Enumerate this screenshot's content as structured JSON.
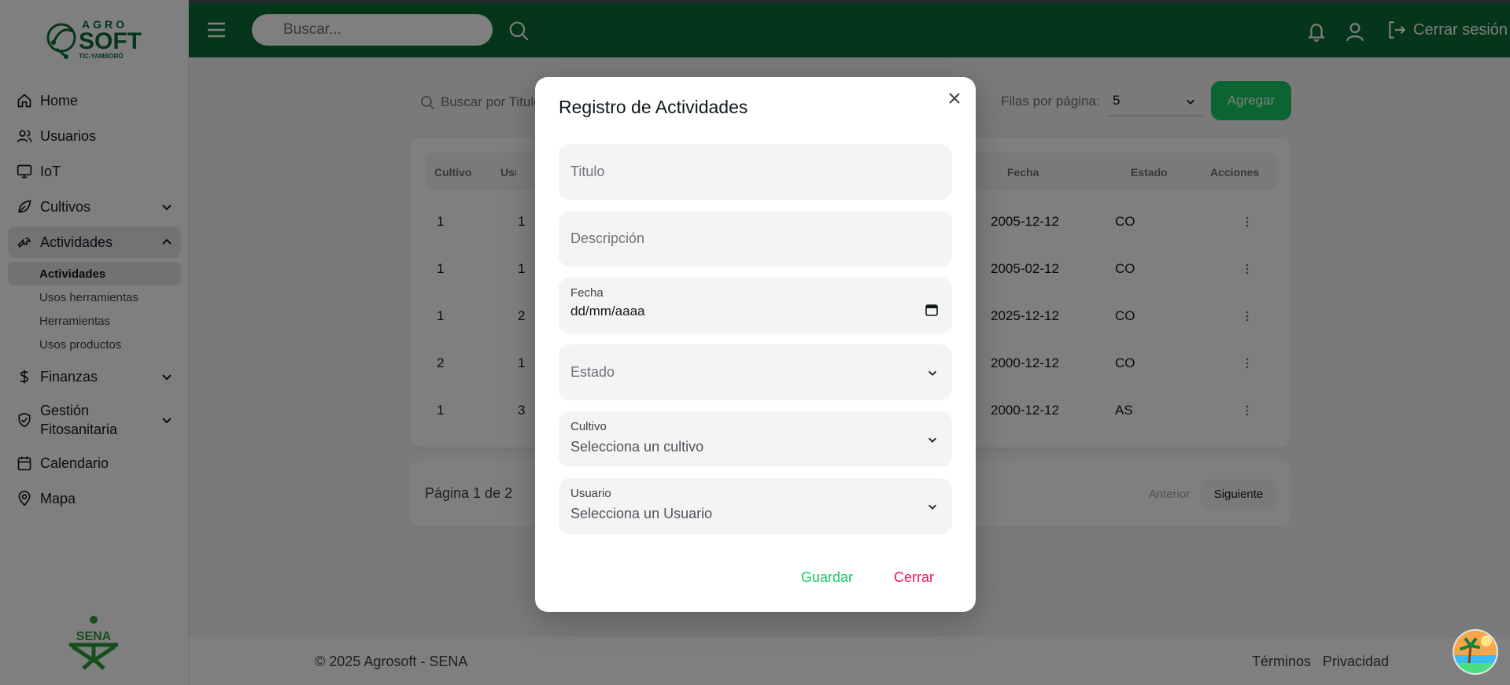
{
  "brand": {
    "logo_top": "AGRO",
    "logo_main": "SOFT",
    "logo_sub": "TIC-YAMBORÓ",
    "sena_text": "SENA",
    "primary_color": "#0b6b36",
    "accent_green": "#17c964",
    "danger_red": "#f31260"
  },
  "sidebar": {
    "items": [
      {
        "label": "Home",
        "icon": "home-icon"
      },
      {
        "label": "Usuarios",
        "icon": "users-icon"
      },
      {
        "label": "IoT",
        "icon": "monitor-icon"
      },
      {
        "label": "Cultivos",
        "icon": "leaf-icon"
      },
      {
        "label": "Actividades",
        "icon": "wrench-icon"
      },
      {
        "label": "Finanzas",
        "icon": "dollar-icon"
      },
      {
        "label": "Gestión Fitosanitaria",
        "icon": "shield-icon"
      },
      {
        "label": "Calendario",
        "icon": "calendar-icon"
      },
      {
        "label": "Mapa",
        "icon": "map-pin-icon"
      }
    ],
    "sub_items": [
      "Actividades",
      "Usos herramientas",
      "Herramientas",
      "Usos productos"
    ]
  },
  "header": {
    "search_placeholder": "Buscar...",
    "logout_label": "Cerrar sesión"
  },
  "main": {
    "search_placeholder": "Buscar por Titulo",
    "rows_label": "Filas por página:",
    "rows_value": "5",
    "add_label": "Agregar",
    "columns": [
      "Cultivo",
      "Usuario",
      "Fecha",
      "Estado",
      "Acciones"
    ],
    "rows": [
      {
        "cultivo": "1",
        "usuario": "1",
        "fecha": "2005-12-12",
        "estado": "CO"
      },
      {
        "cultivo": "1",
        "usuario": "1",
        "fecha": "2005-02-12",
        "estado": "CO"
      },
      {
        "cultivo": "1",
        "usuario": "2",
        "fecha": "2025-12-12",
        "estado": "CO"
      },
      {
        "cultivo": "2",
        "usuario": "1",
        "fecha": "2000-12-12",
        "estado": "CO"
      },
      {
        "cultivo": "1",
        "usuario": "3",
        "fecha": "2000-12-12",
        "estado": "AS"
      }
    ],
    "pagination": {
      "text": "Página 1 de 2",
      "prev": "Anterior",
      "next": "Siguiente"
    }
  },
  "footer": {
    "copyright": "© 2025 Agrosoft - SENA",
    "terms": "Términos",
    "privacy": "Privacidad"
  },
  "modal": {
    "title": "Registro de Actividades",
    "titulo_placeholder": "Titulo",
    "descripcion_placeholder": "Descripción",
    "fecha_label": "Fecha",
    "fecha_value": "dd/mm/aaaa",
    "estado_placeholder": "Estado",
    "cultivo_label": "Cultivo",
    "cultivo_value": "Selecciona un cultivo",
    "usuario_label": "Usuario",
    "usuario_value": "Selecciona un Usuario",
    "save_label": "Guardar",
    "close_label": "Cerrar"
  }
}
